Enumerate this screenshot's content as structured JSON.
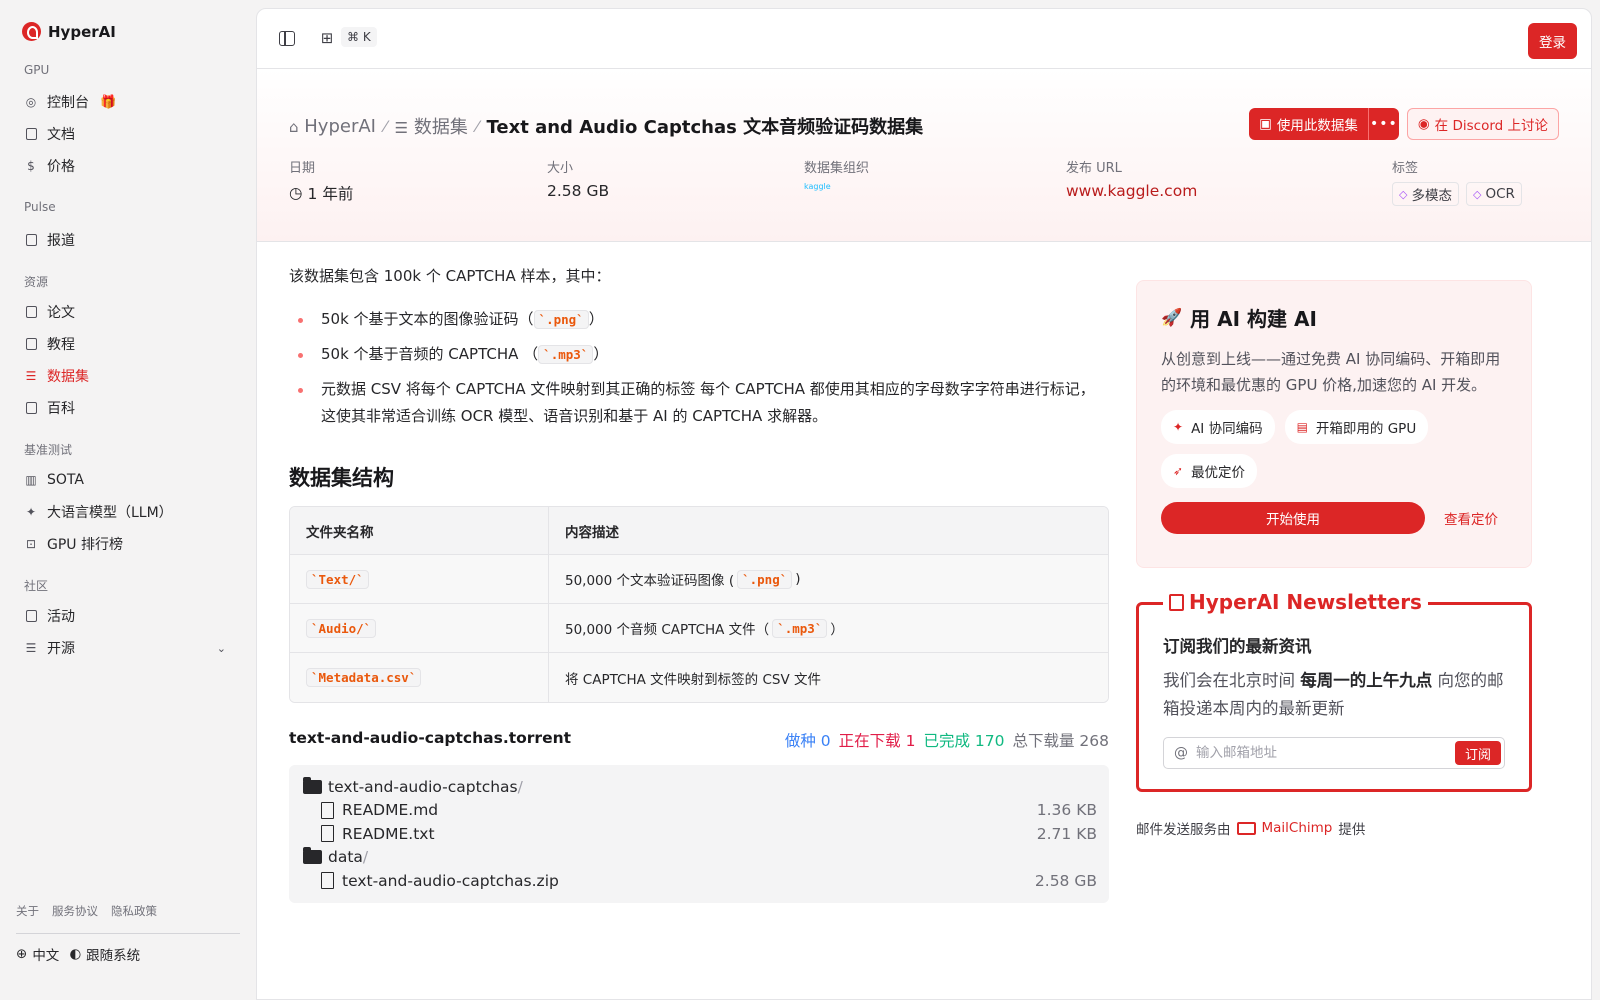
{
  "brand": {
    "name": "HyperAI"
  },
  "sidebar": {
    "sections": [
      {
        "label": "GPU"
      },
      {
        "label": "Pulse"
      },
      {
        "label": "资源"
      },
      {
        "label": "基准测试"
      },
      {
        "label": "社区"
      }
    ],
    "items": [
      {
        "label": "控制台",
        "icon": "dashboard-icon"
      },
      {
        "label": "文档",
        "icon": "doc-icon"
      },
      {
        "label": "价格",
        "icon": "dollar-icon"
      },
      {
        "label": "报道",
        "icon": "news-icon"
      },
      {
        "label": "论文",
        "icon": "paper-icon"
      },
      {
        "label": "教程",
        "icon": "book-icon"
      },
      {
        "label": "数据集",
        "icon": "database-icon",
        "active": true
      },
      {
        "label": "百科",
        "icon": "wiki-icon"
      },
      {
        "label": "SOTA",
        "icon": "bar-chart-icon"
      },
      {
        "label": "大语言模型（LLM）",
        "icon": "sparkle-icon"
      },
      {
        "label": "GPU 排行榜",
        "icon": "cpu-icon"
      },
      {
        "label": "活动",
        "icon": "calendar-icon"
      },
      {
        "label": "开源",
        "icon": "list-icon"
      }
    ],
    "footer_links": [
      "关于",
      "服务协议",
      "隐私政策"
    ],
    "language": "中文",
    "theme": "跟随系统"
  },
  "topbar": {
    "shortcut": "⌘ K",
    "login_label": "登录"
  },
  "header": {
    "breadcrumb": [
      "HyperAI",
      "数据集",
      "Text and Audio Captchas 文本音频验证码数据集"
    ],
    "use_dataset_label": "使用此数据集",
    "discord_label": "在 Discord 上讨论",
    "meta": {
      "date_label": "日期",
      "date_value": "1 年前",
      "size_label": "大小",
      "size_value": "2.58 GB",
      "org_label": "数据集组织",
      "org_value": "kaggle",
      "url_label": "发布 URL",
      "url_value": "www.kaggle.com",
      "tags_label": "标签",
      "tags": [
        "多模态",
        "OCR"
      ]
    }
  },
  "content": {
    "intro": "该数据集包含 100k 个 CAPTCHA 样本，其中：",
    "bullets": [
      {
        "before": "50k 个基于文本的图像验证码（",
        "code": "`.png`",
        "after": "）"
      },
      {
        "before": "50k 个基于音频的 CAPTCHA （",
        "code": "`.mp3`",
        "after": "）"
      },
      {
        "text": "元数据 CSV 将每个 CAPTCHA 文件映射到其正确的标签 每个 CAPTCHA 都使用其相应的字母数字字符串进行标记，这使其非常适合训练 OCR 模型、语音识别和基于 AI 的 CAPTCHA 求解器。"
      }
    ],
    "structure_heading": "数据集结构",
    "table": {
      "headers": [
        "文件夹名称",
        "内容描述"
      ],
      "rows": [
        {
          "name": "`Text/`",
          "desc_before": "50,000 个文本验证码图像 (",
          "desc_code": "`.png`",
          "desc_after": ")"
        },
        {
          "name": "`Audio/`",
          "desc_before": "50,000 个音频 CAPTCHA 文件（",
          "desc_code": "`.mp3`",
          "desc_after": "）"
        },
        {
          "name": "`Metadata.csv`",
          "desc_before": "将 CAPTCHA 文件映射到标签的 CSV 文件",
          "desc_code": "",
          "desc_after": ""
        }
      ]
    },
    "torrent": {
      "name": "text-and-audio-captchas.torrent",
      "seeding": "做种 0",
      "downloading": "正在下载 1",
      "completed": "已完成 170",
      "total": "总下载量 268",
      "files": [
        {
          "type": "folder",
          "name": "text-and-audio-captchas",
          "size": ""
        },
        {
          "type": "file",
          "name": "README.md",
          "size": "1.36 KB"
        },
        {
          "type": "file",
          "name": "README.txt",
          "size": "2.71 KB"
        },
        {
          "type": "folder",
          "name": "data",
          "size": ""
        },
        {
          "type": "file",
          "name": "text-and-audio-captchas.zip",
          "size": "2.58 GB"
        }
      ]
    }
  },
  "promo": {
    "title": "用 AI 构建 AI",
    "desc": "从创意到上线——通过免费 AI 协同编码、开箱即用的环境和最优惠的 GPU 价格,加速您的 AI 开发。",
    "chips": [
      "AI 协同编码",
      "开箱即用的 GPU",
      "最优定价"
    ],
    "start_label": "开始使用",
    "pricing_label": "查看定价"
  },
  "newsletter": {
    "title": "HyperAI Newsletters",
    "subtitle": "订阅我们的最新资讯",
    "desc_before": "我们会在北京时间 ",
    "desc_bold": "每周一的上午九点",
    "desc_after": " 向您的邮箱投递本周内的最新更新",
    "email_placeholder": "输入邮箱地址",
    "subscribe_label": "订阅",
    "footer_before": "邮件发送服务由",
    "footer_brand": "MailChimp",
    "footer_after": "提供"
  },
  "colors": {
    "accent": "#dc2626",
    "seed": "#3b82f6",
    "downloading": "#e11d48",
    "completed": "#10b981"
  }
}
